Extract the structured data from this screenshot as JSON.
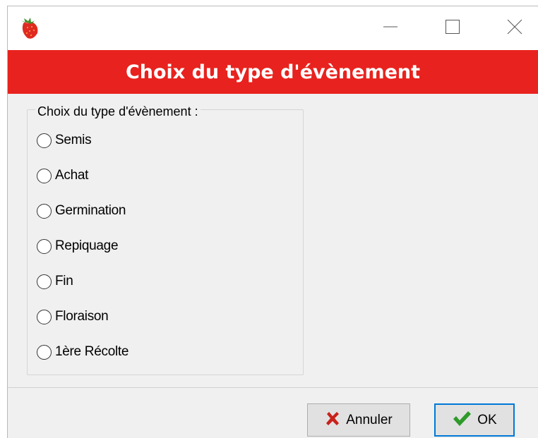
{
  "window": {
    "icon": "strawberry-icon",
    "controls": [
      "minimize-icon",
      "maximize-icon",
      "close-icon"
    ]
  },
  "banner": {
    "title": "Choix du type d'évènement",
    "background": "#e8221e"
  },
  "group": {
    "legend": "Choix du type d'évènement :",
    "options": [
      {
        "label": "Semis",
        "selected": false
      },
      {
        "label": "Achat",
        "selected": false
      },
      {
        "label": "Germination",
        "selected": false
      },
      {
        "label": "Repiquage",
        "selected": false
      },
      {
        "label": "Fin",
        "selected": false
      },
      {
        "label": "Floraison",
        "selected": false
      },
      {
        "label": "1ère Récolte",
        "selected": false
      }
    ]
  },
  "buttons": {
    "cancel_label": "Annuler",
    "cancel_icon": "x-cross-icon",
    "ok_label": "OK",
    "ok_icon": "checkmark-icon",
    "focus_color": "#0078d7"
  }
}
